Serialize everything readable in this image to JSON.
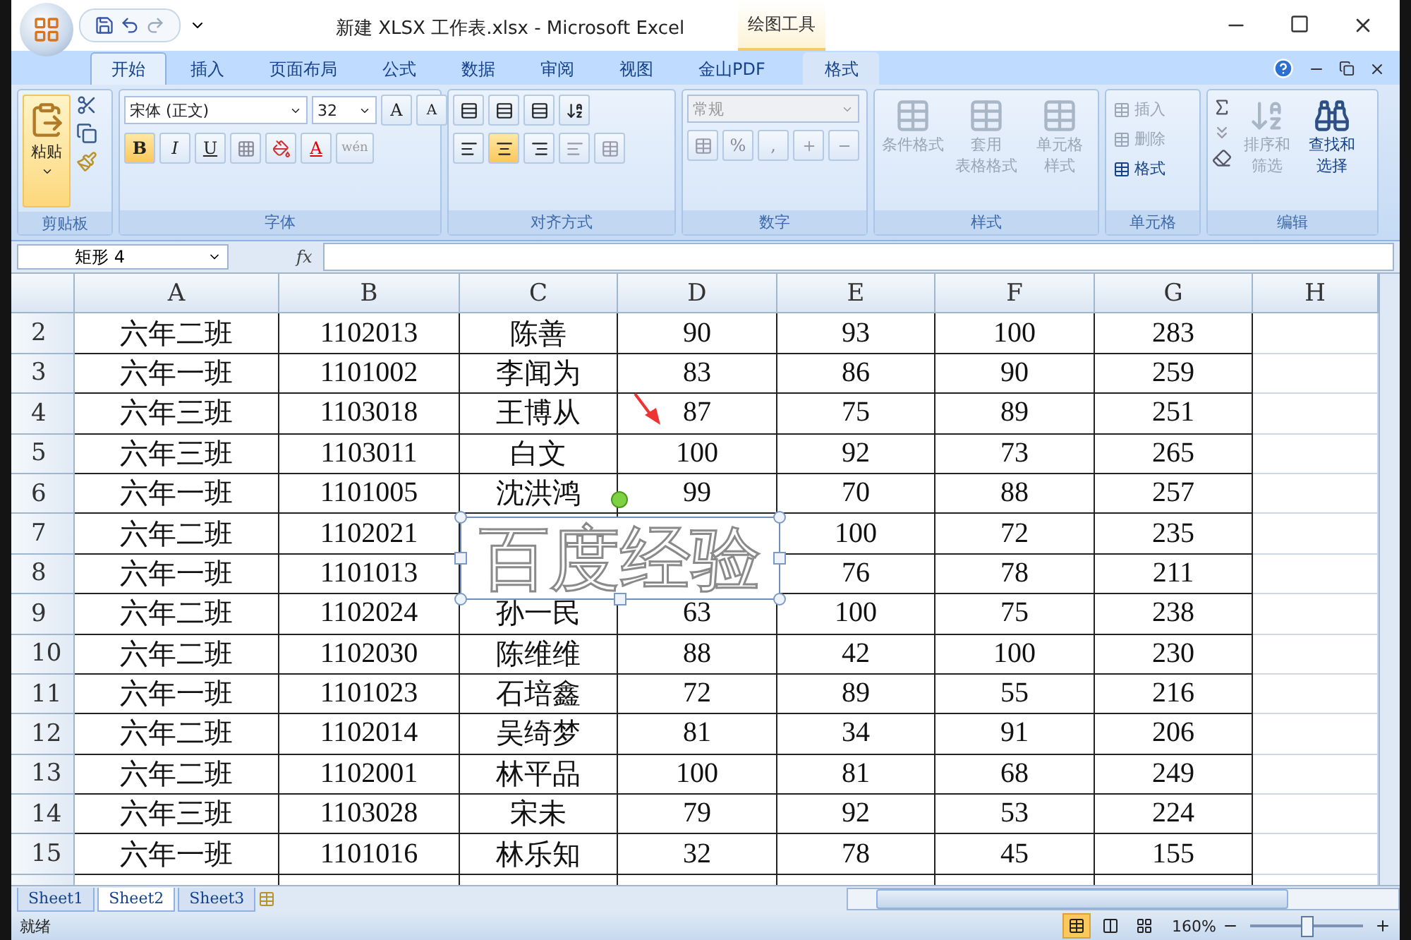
{
  "title_bar": {
    "title": "新建 XLSX 工作表.xlsx - Microsoft Excel",
    "context_label": "绘图工具"
  },
  "tabs": [
    {
      "label": "开始",
      "selected": true,
      "kind": "normal"
    },
    {
      "label": "插入",
      "selected": false,
      "kind": "normal"
    },
    {
      "label": "页面布局",
      "selected": false,
      "kind": "normal"
    },
    {
      "label": "公式",
      "selected": false,
      "kind": "normal"
    },
    {
      "label": "数据",
      "selected": false,
      "kind": "normal"
    },
    {
      "label": "审阅",
      "selected": false,
      "kind": "normal"
    },
    {
      "label": "视图",
      "selected": false,
      "kind": "normal"
    },
    {
      "label": "金山PDF",
      "selected": false,
      "kind": "normal"
    },
    {
      "label": "格式",
      "selected": false,
      "kind": "context"
    }
  ],
  "ribbon": {
    "clipboard": {
      "label": "剪贴板",
      "paste": "粘贴"
    },
    "font": {
      "label": "字体",
      "font_name": "宋体 (正文)",
      "font_size": "32",
      "grow": "A",
      "shrink": "A",
      "styles": [
        {
          "label": "B",
          "selected": true
        },
        {
          "label": "I",
          "selected": false
        },
        {
          "label": "U",
          "selected": false
        }
      ],
      "color_letter": "A",
      "phonetic": "wén"
    },
    "alignment": {
      "label": "对齐方式",
      "horizontal": [
        {
          "selected": false
        },
        {
          "selected": true
        },
        {
          "selected": false
        }
      ]
    },
    "number": {
      "label": "数字",
      "format": "常规",
      "percent": "%",
      "comma": ","
    },
    "styles": {
      "label": "样式",
      "buttons": [
        {
          "lines": [
            "条件格式"
          ],
          "disabled": true
        },
        {
          "lines": [
            "套用",
            "表格格式"
          ],
          "disabled": true
        },
        {
          "lines": [
            "单元格",
            "样式"
          ],
          "disabled": true
        }
      ]
    },
    "cells": {
      "label": "单元格",
      "items": [
        {
          "label": "插入",
          "disabled": true
        },
        {
          "label": "删除",
          "disabled": true
        },
        {
          "label": "格式",
          "disabled": false
        }
      ]
    },
    "editing": {
      "label": "编辑",
      "buttons": [
        {
          "lines": [
            "排序和",
            "筛选"
          ],
          "disabled": true
        },
        {
          "lines": [
            "查找和",
            "选择"
          ],
          "disabled": false
        }
      ]
    }
  },
  "formula_bar": {
    "name_box": "矩形 4",
    "fx": "fx"
  },
  "columns": [
    "A",
    "B",
    "C",
    "D",
    "E",
    "F",
    "G",
    "H"
  ],
  "rows": [
    {
      "header": "2",
      "cells": [
        "六年二班",
        "1102013",
        "陈善",
        "90",
        "93",
        "100",
        "283"
      ]
    },
    {
      "header": "3",
      "cells": [
        "六年一班",
        "1101002",
        "李闻为",
        "83",
        "86",
        "90",
        "259"
      ]
    },
    {
      "header": "4",
      "cells": [
        "六年三班",
        "1103018",
        "王博从",
        "87",
        "75",
        "89",
        "251"
      ]
    },
    {
      "header": "5",
      "cells": [
        "六年三班",
        "1103011",
        "白文",
        "100",
        "92",
        "73",
        "265"
      ]
    },
    {
      "header": "6",
      "cells": [
        "六年一班",
        "1101005",
        "沈洪鸿",
        "99",
        "70",
        "88",
        "257"
      ]
    },
    {
      "header": "7",
      "cells": [
        "六年二班",
        "1102021",
        null,
        null,
        "100",
        "72",
        "235"
      ]
    },
    {
      "header": "8",
      "cells": [
        "六年一班",
        "1101013",
        null,
        null,
        "76",
        "78",
        "211"
      ]
    },
    {
      "header": "9",
      "cells": [
        "六年二班",
        "1102024",
        "孙一民",
        "63",
        "100",
        "75",
        "238"
      ]
    },
    {
      "header": "10",
      "cells": [
        "六年二班",
        "1102030",
        "陈维维",
        "88",
        "42",
        "100",
        "230"
      ]
    },
    {
      "header": "11",
      "cells": [
        "六年一班",
        "1101023",
        "石培鑫",
        "72",
        "89",
        "55",
        "216"
      ]
    },
    {
      "header": "12",
      "cells": [
        "六年二班",
        "1102014",
        "吴绮梦",
        "81",
        "34",
        "91",
        "206"
      ]
    },
    {
      "header": "13",
      "cells": [
        "六年二班",
        "1102001",
        "林平品",
        "100",
        "81",
        "68",
        "249"
      ]
    },
    {
      "header": "14",
      "cells": [
        "六年三班",
        "1103028",
        "宋未",
        "79",
        "92",
        "53",
        "224"
      ]
    },
    {
      "header": "15",
      "cells": [
        "六年一班",
        "1101016",
        "林乐知",
        "32",
        "78",
        "45",
        "155"
      ]
    }
  ],
  "shape": {
    "text": "百度经验"
  },
  "sheets": [
    {
      "label": "Sheet1",
      "selected": false
    },
    {
      "label": "Sheet2",
      "selected": true
    },
    {
      "label": "Sheet3",
      "selected": false
    }
  ],
  "status_bar": {
    "status": "就绪",
    "views": [
      {
        "selected": true
      },
      {
        "selected": false
      },
      {
        "selected": false
      }
    ],
    "zoom": "160%",
    "zoom_slider": {
      "level": 0.5
    }
  }
}
